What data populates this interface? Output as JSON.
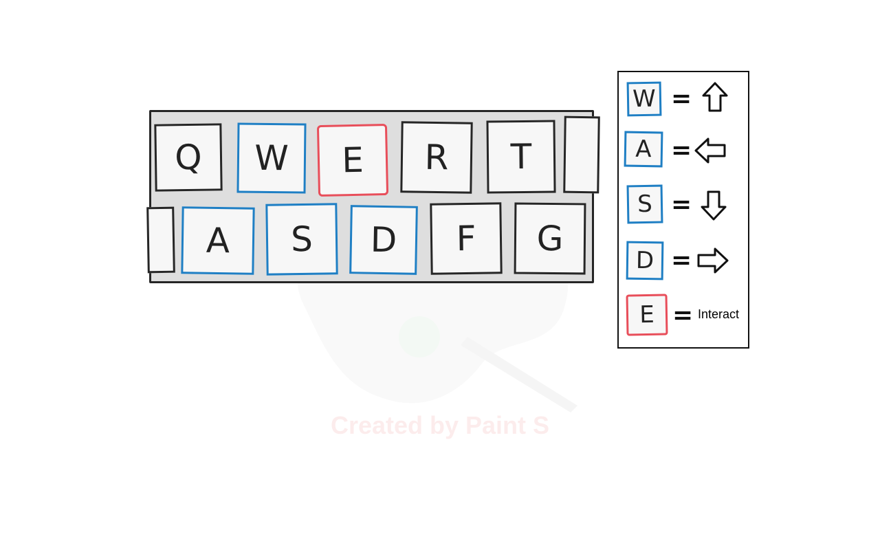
{
  "keyboard": {
    "rows": [
      [
        "Q",
        "W",
        "E",
        "R",
        "T"
      ],
      [
        "A",
        "S",
        "D",
        "F",
        "G"
      ]
    ],
    "movement_key_color": "#1f7fc4",
    "interact_key_color": "#e84e5a",
    "plain_key_border_color": "#262626",
    "panel_color": "#dedede"
  },
  "legend": {
    "items": [
      {
        "key": "W",
        "icon": "arrow-up-icon"
      },
      {
        "key": "A",
        "icon": "arrow-left-icon"
      },
      {
        "key": "S",
        "icon": "arrow-down-icon"
      },
      {
        "key": "D",
        "icon": "arrow-right-icon"
      },
      {
        "key": "E",
        "label": "Interact"
      }
    ],
    "equals": "="
  },
  "watermark": {
    "text": "Created by Paint S"
  }
}
